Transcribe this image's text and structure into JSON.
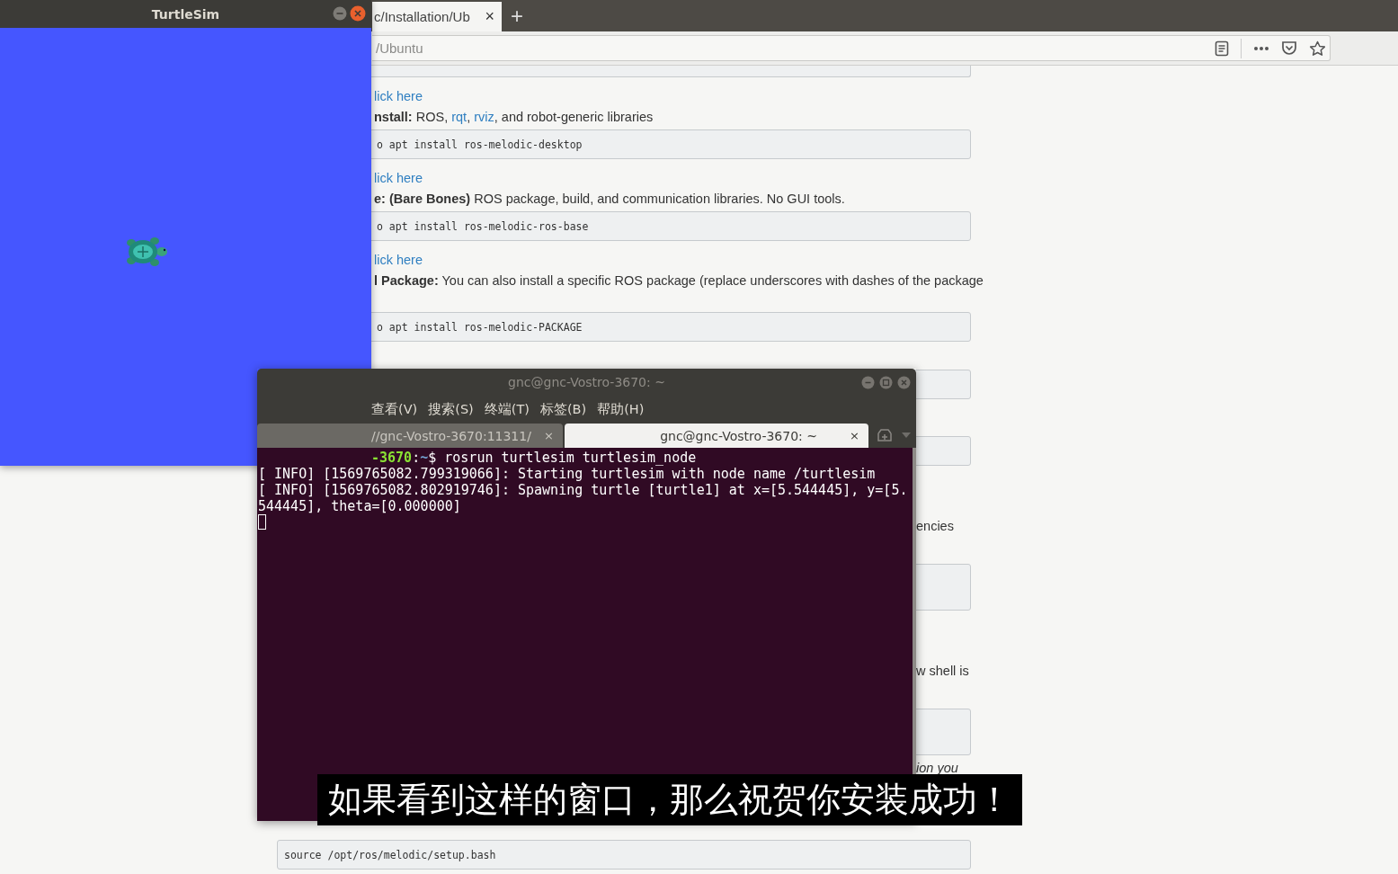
{
  "browser": {
    "tab": {
      "title": "c/Installation/Ub",
      "close": "×"
    },
    "new_tab": "+",
    "url": "/Ubuntu",
    "content": [
      {
        "kind": "code"
      },
      {
        "kind": "link",
        "text": "lick here"
      },
      {
        "kind": "text",
        "segments": [
          "**nstall:** ROS, ",
          "rqt",
          ", ",
          "rviz",
          ", and robot-generic libraries"
        ]
      },
      {
        "kind": "code",
        "text": "o apt install ros-melodic-desktop"
      },
      {
        "kind": "link",
        "text": "lick here"
      },
      {
        "kind": "text",
        "segments": [
          "**e: (Bare Bones)** ROS package, build, and communication libraries. No GUI tools."
        ]
      },
      {
        "kind": "code",
        "text": "o apt install ros-melodic-ros-base"
      },
      {
        "kind": "link",
        "text": "lick here"
      },
      {
        "kind": "text",
        "segments": [
          "**l Package:** You can also install a specific ROS package (replace underscores with dashes of the package"
        ]
      },
      {
        "kind": "code",
        "text": "o apt install ros-melodic-PACKAGE"
      },
      {
        "kind": "code"
      },
      {
        "kind": "code"
      },
      {
        "kind": "text",
        "segments": [
          "encies"
        ]
      },
      {
        "kind": "code"
      },
      {
        "kind": "text",
        "segments": [
          "w shell is"
        ]
      },
      {
        "kind": "code"
      },
      {
        "kind": "note",
        "text": "ion you"
      },
      {
        "kind": "code",
        "text": "source /opt/ros/melodic/setup.bash"
      }
    ]
  },
  "turtlesim": {
    "title": "TurtleSim"
  },
  "terminal": {
    "title": "gnc@gnc-Vostro-3670: ~",
    "menu": [
      "查看(V)",
      "搜索(S)",
      "终端(T)",
      "标签(B)",
      "帮助(H)"
    ],
    "tabs": [
      {
        "title": "//gnc-Vostro-3670:11311/",
        "close": "×",
        "selected": false
      },
      {
        "title": "gnc@gnc-Vostro-3670: ~",
        "close": "×",
        "selected": true
      }
    ],
    "prompt": {
      "host": "-3670",
      "separator": ":",
      "path": "~",
      "command": "$ rosrun turtlesim turtlesim_node"
    },
    "output": [
      "[ INFO] [1569765082.799319066]: Starting turtlesim with node name /turtlesim",
      "[ INFO] [1569765082.802919746]: Spawning turtle [turtle1] at x=[5.544445], y=[5.",
      "544445], theta=[0.000000]"
    ]
  },
  "subtitle": "如果看到这样的窗口，那么祝贺你安装成功！"
}
